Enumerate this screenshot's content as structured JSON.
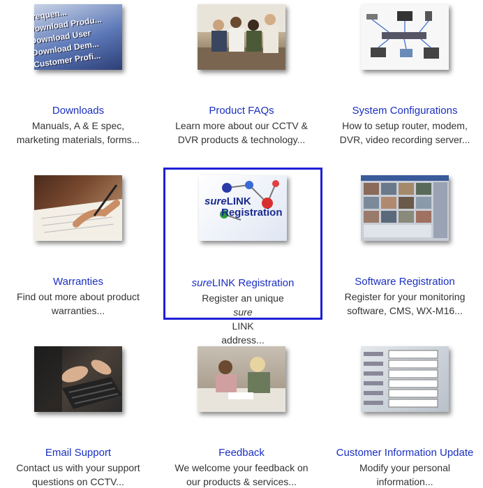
{
  "tiles": [
    {
      "id": "downloads",
      "title": "Downloads",
      "desc_lines": [
        "Manuals, A & E spec,",
        "marketing materials, forms..."
      ],
      "thumb_text": [
        "Frequen...",
        "Download Produ...",
        "Download User",
        "Download Dem...",
        "Customer Profi..."
      ]
    },
    {
      "id": "product-faqs",
      "title": "Product FAQs",
      "desc_lines": [
        "Learn more about our CCTV &",
        "DVR products & technology..."
      ]
    },
    {
      "id": "system-configurations",
      "title": "System Configurations",
      "desc_lines": [
        "How to setup router, modem,",
        "DVR, video recording server..."
      ]
    },
    {
      "id": "warranties",
      "title": "Warranties",
      "desc_lines": [
        "Find out more about product",
        "warranties..."
      ]
    },
    {
      "id": "surelink-registration",
      "title_italic": "sure",
      "title_rest": "LINK Registration",
      "desc_pre": "Register an unique ",
      "desc_italic": "sure",
      "desc_post": "LINK",
      "desc_line2": "address...",
      "thumb_italic": "sure",
      "thumb_rest": "LINK",
      "thumb_line2": "Registration"
    },
    {
      "id": "software-registration",
      "title": "Software Registration",
      "desc_lines": [
        "Register for your monitoring",
        "software, CMS, WX-M16..."
      ]
    },
    {
      "id": "email-support",
      "title": "Email Support",
      "desc_lines": [
        "Contact us with your support",
        "questions on CCTV..."
      ]
    },
    {
      "id": "feedback",
      "title": "Feedback",
      "desc_lines": [
        "We welcome your feedback on",
        "our products & services..."
      ]
    },
    {
      "id": "customer-information-update",
      "title": "Customer Information Update",
      "desc_lines": [
        "Modify your personal",
        "information..."
      ]
    }
  ],
  "colors": {
    "link": "#1a2fc0",
    "text": "#333333",
    "selected_border": "#1f1fd6"
  }
}
